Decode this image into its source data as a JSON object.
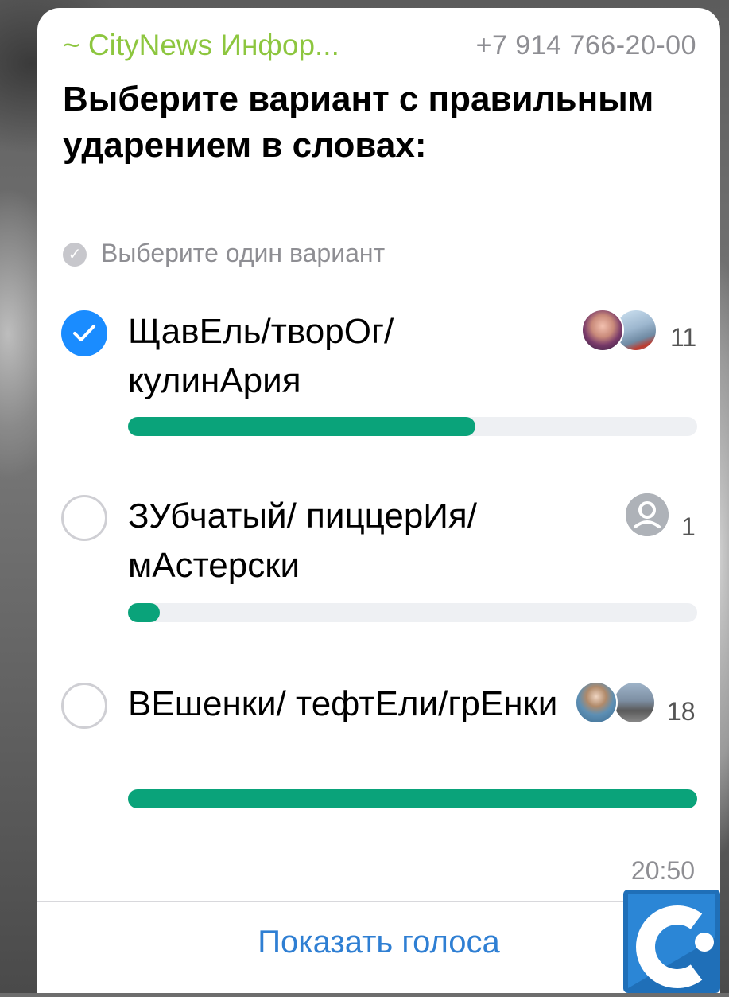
{
  "header": {
    "sender": "~ CityNews Инфор...",
    "phone": "+7 914 766-20-00"
  },
  "poll": {
    "question": "Выберите вариант с правильным ударением в словах:",
    "hint": "Выберите один вариант",
    "options": [
      {
        "label": "ЩавЕль/творОг/ кулинАрия",
        "votes": "11",
        "checked": true,
        "fraction": 0.61,
        "avatars": [
          "avatar-woman",
          "avatar-photo"
        ]
      },
      {
        "label": "ЗУбчатый/ пиццерИя/ мАстерски",
        "votes": "1",
        "checked": false,
        "fraction": 0.056,
        "avatars": [
          "avatar-placeholder"
        ]
      },
      {
        "label": "ВЕшенки/ тефтЕли/грЕнки",
        "votes": "18",
        "checked": false,
        "fraction": 1.0,
        "avatars": [
          "avatar-man",
          "avatar-street"
        ]
      }
    ],
    "time": "20:50",
    "show_votes": "Показать голоса"
  },
  "colors": {
    "sender": "#8dc63f",
    "accent_blue": "#1a8cff",
    "bar_fill": "#0aa37a",
    "bar_track": "#eef0f3",
    "link": "#2f7fd3"
  }
}
